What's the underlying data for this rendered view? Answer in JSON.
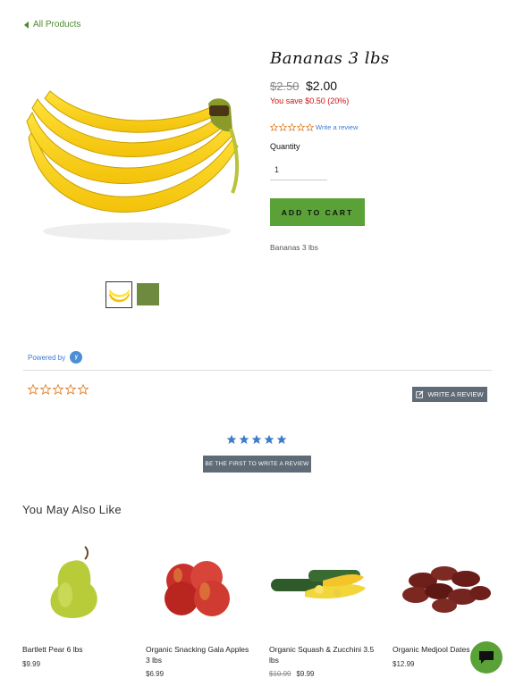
{
  "nav": {
    "back_label": "All Products"
  },
  "product": {
    "title": "Bananas 3 lbs",
    "price_old": "$2.50",
    "price_new": "$2.00",
    "savings": "You save $0.50 (20%)",
    "rating": 0,
    "write_review": "Write a review",
    "quantity_label": "Quantity",
    "quantity_value": "1",
    "add_to_cart": "ADD TO CART",
    "description": "Bananas 3 lbs",
    "hero_icon": "bananas-image",
    "thumbnails": [
      "bananas-thumbnail",
      "green-bananas-thumbnail"
    ]
  },
  "reviews": {
    "powered_by": "Powered by",
    "rating": 0,
    "write_review_button": "WRITE A REVIEW",
    "first_review_button": "BE THE FIRST TO WRITE A REVIEW"
  },
  "recommendations": {
    "title": "You May Also Like",
    "items": [
      {
        "name": "Bartlett Pear 6 lbs",
        "price": "$9.99",
        "old_price": "",
        "image": "pear-image"
      },
      {
        "name": "Organic Snacking Gala Apples 3 lbs",
        "price": "$6.99",
        "old_price": "",
        "image": "apples-image"
      },
      {
        "name": "Organic Squash & Zucchini 3.5 lbs",
        "price": "$9.99",
        "old_price": "$10.99",
        "image": "squash-image"
      },
      {
        "name": "Organic Medjool Dates",
        "price": "$12.99",
        "old_price": "",
        "image": "dates-image"
      }
    ]
  },
  "colors": {
    "accent_green": "#5aa238",
    "sale_red": "#d10f0f",
    "link_blue": "#3a7bd5",
    "button_gray": "#5f6b76"
  }
}
